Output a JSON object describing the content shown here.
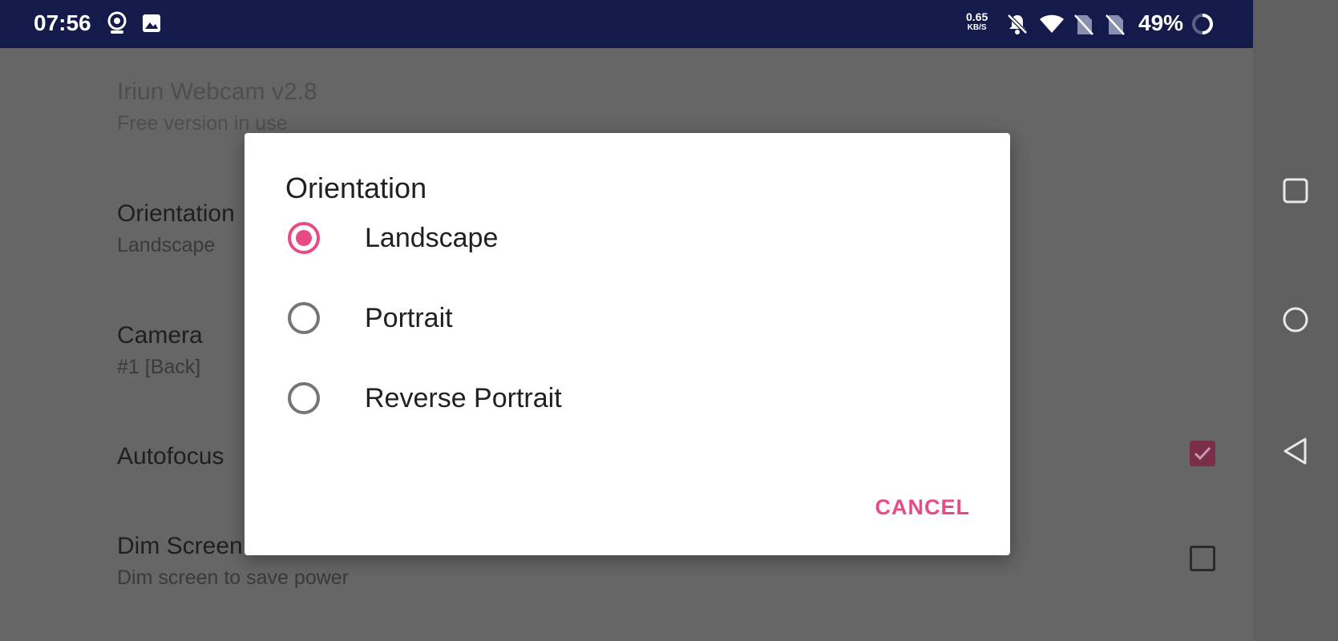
{
  "status_bar": {
    "time": "07:56",
    "net_speed_value": "0.65",
    "net_speed_unit": "KB/S",
    "battery_percent": "49%",
    "icons": [
      "webcam-icon",
      "image-icon",
      "mute-bell-icon",
      "wifi-icon",
      "no-sim-icon",
      "no-sim-icon",
      "battery-ring-icon"
    ]
  },
  "settings": {
    "items": [
      {
        "title": "Iriun Webcam v2.8",
        "summary": "Free version in use"
      },
      {
        "title": "Orientation",
        "summary": "Landscape"
      },
      {
        "title": "Camera",
        "summary": "#1 [Back]"
      },
      {
        "title": "Autofocus",
        "summary": ""
      },
      {
        "title": "Dim Screen",
        "summary": "Dim screen to save power"
      }
    ],
    "autofocus_checked": true,
    "dim_screen_checked": false
  },
  "dialog": {
    "title": "Orientation",
    "options": [
      {
        "label": "Landscape",
        "selected": true
      },
      {
        "label": "Portrait",
        "selected": false
      },
      {
        "label": "Reverse Portrait",
        "selected": false
      }
    ],
    "cancel_label": "CANCEL"
  },
  "nav_bar": {
    "buttons": [
      "recents-square-icon",
      "home-circle-icon",
      "back-triangle-icon"
    ]
  },
  "colors": {
    "accent": "#e84a87",
    "status_bar": "#141a4a",
    "scrim": "#666666"
  }
}
